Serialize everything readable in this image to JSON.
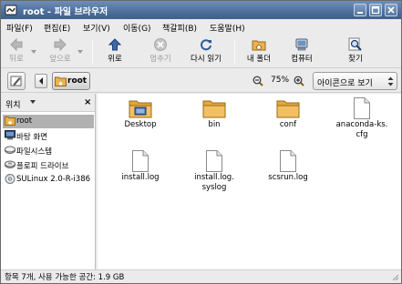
{
  "window": {
    "title": "root - 파일 브라우저"
  },
  "menubar": {
    "items": [
      "파일(F)",
      "편집(E)",
      "보기(V)",
      "이동(G)",
      "책갈피(B)",
      "도움말(H)"
    ]
  },
  "toolbar": {
    "back": "뒤로",
    "forward": "앞으로",
    "up": "위로",
    "stop": "멈추기",
    "reload": "다시 읽기",
    "home": "내 폴더",
    "computer": "컴퓨터",
    "search": "찾기"
  },
  "location": {
    "current_path": "root",
    "zoom_level": "75%",
    "view_mode": "아이콘으로 보기"
  },
  "sidebar": {
    "header": "위치",
    "close": "×",
    "items": [
      {
        "label": "root",
        "icon": "home-icon",
        "selected": true
      },
      {
        "label": "바탕 화면",
        "icon": "desktop-icon",
        "selected": false
      },
      {
        "label": "파일시스템",
        "icon": "filesystem-icon",
        "selected": false
      },
      {
        "label": "플로피 드라이브",
        "icon": "floppy-icon",
        "selected": false
      },
      {
        "label": "SULinux 2.0-R-i386",
        "icon": "cdrom-icon",
        "selected": false
      }
    ]
  },
  "files": [
    {
      "name": "Desktop",
      "type": "folder-desktop"
    },
    {
      "name": "bin",
      "type": "folder"
    },
    {
      "name": "conf",
      "type": "folder"
    },
    {
      "name": "anaconda-ks.\ncfg",
      "type": "file"
    },
    {
      "name": "install.log",
      "type": "file"
    },
    {
      "name": "install.log.\nsyslog",
      "type": "file"
    },
    {
      "name": "scsrun.log",
      "type": "file"
    }
  ],
  "statusbar": {
    "text": "항목 7개, 사용 가능한 공간: 1.9 GB"
  },
  "colors": {
    "titlebar": "#4d6f9c",
    "folder": "#f2c063",
    "selected": "#b1b1b1"
  }
}
